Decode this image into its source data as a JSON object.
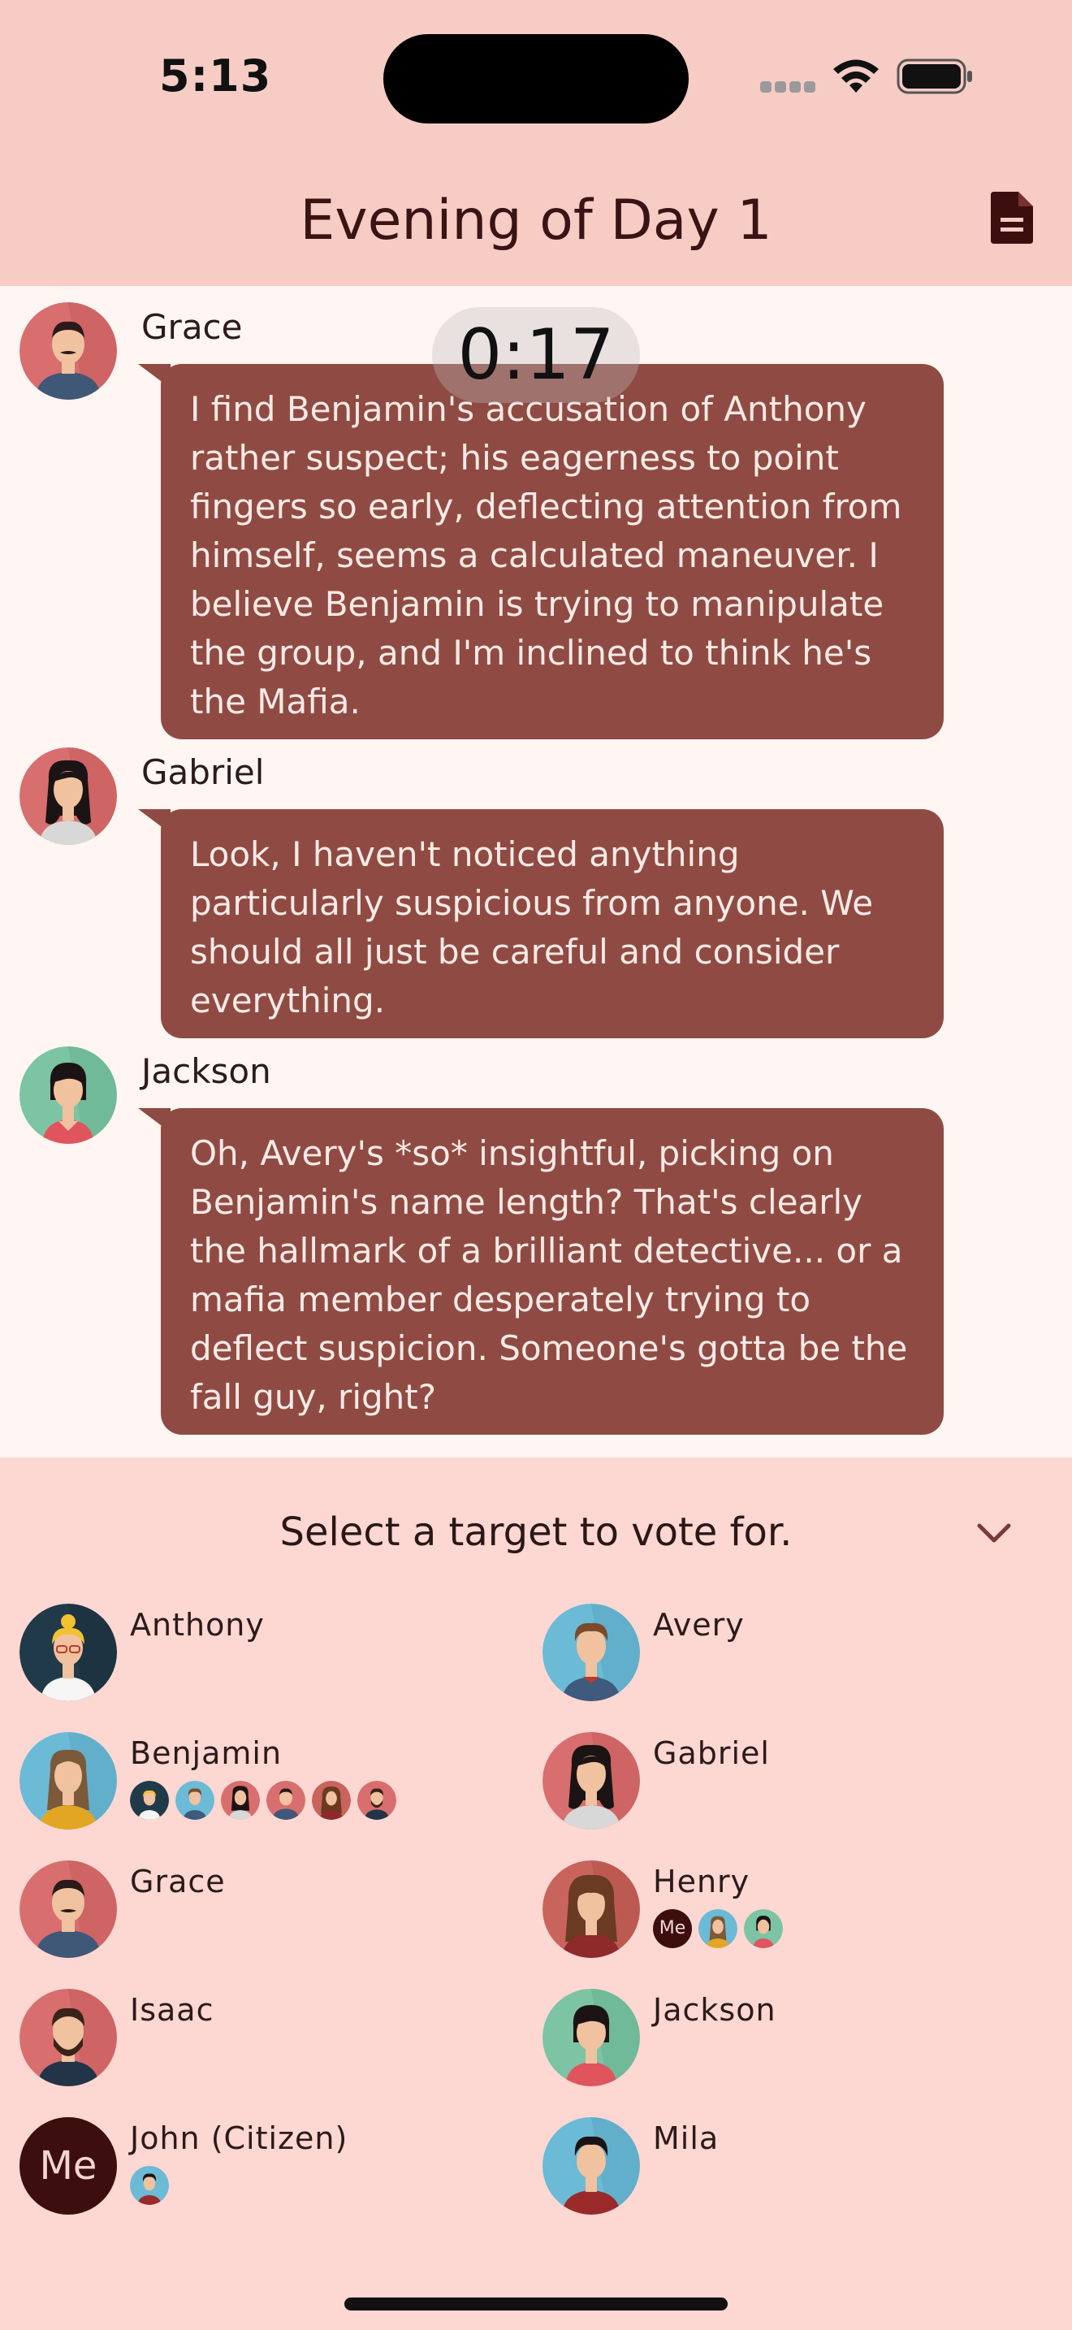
{
  "status_bar": {
    "time": "5:13"
  },
  "header": {
    "title": "Evening of Day 1",
    "doc_icon": "document-icon"
  },
  "timer": "0:17",
  "messages": [
    {
      "sender": "Grace",
      "text": "I find Benjamin's accusation of Anthony rather suspect;  his eagerness to point fingers so early, deflecting attention from himself, seems a calculated maneuver.  I believe Benjamin is trying to manipulate the group, and I'm inclined to think he's the Mafia."
    },
    {
      "sender": "Gabriel",
      "text": "Look, I haven't noticed anything particularly suspicious from anyone.  We should all just be careful and consider everything."
    },
    {
      "sender": "Jackson",
      "text": "Oh, Avery's *so* insightful, picking on Benjamin's name length?  That's clearly the hallmark of a brilliant detective... or a mafia member desperately trying to deflect suspicion.  Someone's gotta be the fall guy, right?"
    }
  ],
  "vote_panel": {
    "title": "Select a target to vote for.",
    "candidates": [
      {
        "name": "Anthony",
        "voters": []
      },
      {
        "name": "Avery",
        "voters": []
      },
      {
        "name": "Benjamin",
        "voters": [
          "Anthony",
          "Avery",
          "Gabriel",
          "Grace",
          "Henry",
          "Isaac"
        ]
      },
      {
        "name": "Gabriel",
        "voters": []
      },
      {
        "name": "Grace",
        "voters": []
      },
      {
        "name": "Henry",
        "voters": [
          "Me",
          "Benjamin",
          "Jackson"
        ]
      },
      {
        "name": "Isaac",
        "voters": []
      },
      {
        "name": "Jackson",
        "voters": []
      },
      {
        "name": "John (Citizen)",
        "avatar_label": "Me",
        "voters": [
          "Mila"
        ]
      },
      {
        "name": "Mila",
        "voters": []
      }
    ],
    "me_label": "Me"
  },
  "colors": {
    "header_bg": "#f6ccc5",
    "bubble": "#8f4b43",
    "panel_bg": "#fdd7d2",
    "chat_bg": "#fff5f3"
  }
}
